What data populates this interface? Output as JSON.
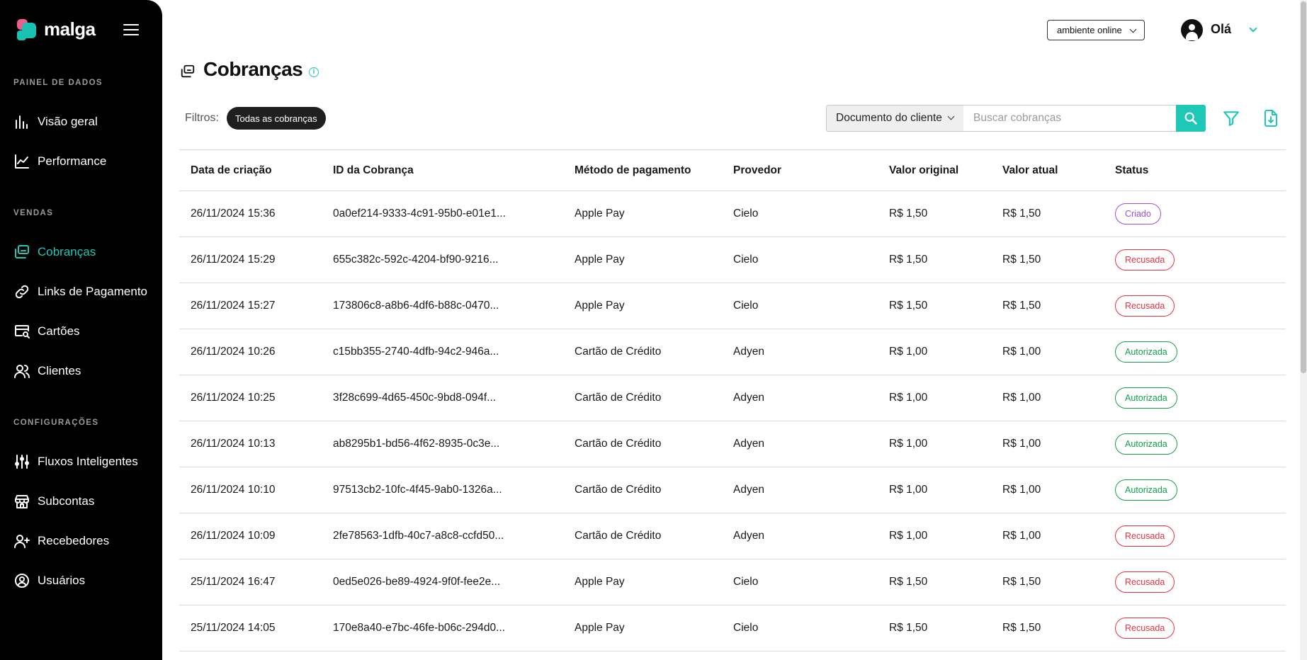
{
  "brand": {
    "name": "malga"
  },
  "sidebar": {
    "sections": [
      {
        "title": "PAINEL DE DADOS",
        "items": [
          {
            "label": "Visão geral",
            "icon": "bar-chart-icon"
          },
          {
            "label": "Performance",
            "icon": "line-chart-icon"
          }
        ]
      },
      {
        "title": "VENDAS",
        "items": [
          {
            "label": "Cobranças",
            "icon": "charges-icon",
            "active": true
          },
          {
            "label": "Links de Pagamento",
            "icon": "link-icon"
          },
          {
            "label": "Cartões",
            "icon": "card-search-icon"
          },
          {
            "label": "Clientes",
            "icon": "users-icon"
          }
        ]
      },
      {
        "title": "CONFIGURAÇÕES",
        "items": [
          {
            "label": "Fluxos Inteligentes",
            "icon": "sliders-icon"
          },
          {
            "label": "Subcontas",
            "icon": "store-icon"
          },
          {
            "label": "Recebedores",
            "icon": "user-plus-icon"
          },
          {
            "label": "Usuários",
            "icon": "user-circle-icon"
          }
        ]
      }
    ]
  },
  "header": {
    "environment": "ambiente online",
    "greeting": "Olá"
  },
  "page": {
    "title": "Cobranças",
    "filters_label": "Filtros:",
    "active_filter": "Todas as cobranças",
    "search_field_select": "Documento do cliente",
    "search_placeholder": "Buscar cobranças"
  },
  "table": {
    "columns": [
      "Data de criação",
      "ID da Cobrança",
      "Método de pagamento",
      "Provedor",
      "Valor original",
      "Valor atual",
      "Status"
    ],
    "rows": [
      {
        "date": "26/11/2024 15:36",
        "id": "0a0ef214-9333-4c91-95b0-e01e1...",
        "method": "Apple Pay",
        "provider": "Cielo",
        "original": "R$ 1,50",
        "current": "R$ 1,50",
        "status": "Criado",
        "status_type": "criado"
      },
      {
        "date": "26/11/2024 15:29",
        "id": "655c382c-592c-4204-bf90-9216...",
        "method": "Apple Pay",
        "provider": "Cielo",
        "original": "R$ 1,50",
        "current": "R$ 1,50",
        "status": "Recusada",
        "status_type": "recusada"
      },
      {
        "date": "26/11/2024 15:27",
        "id": "173806c8-a8b6-4df6-b88c-0470...",
        "method": "Apple Pay",
        "provider": "Cielo",
        "original": "R$ 1,50",
        "current": "R$ 1,50",
        "status": "Recusada",
        "status_type": "recusada"
      },
      {
        "date": "26/11/2024 10:26",
        "id": "c15bb355-2740-4dfb-94c2-946a...",
        "method": "Cartão de Crédito",
        "provider": "Adyen",
        "original": "R$ 1,00",
        "current": "R$ 1,00",
        "status": "Autorizada",
        "status_type": "autorizada"
      },
      {
        "date": "26/11/2024 10:25",
        "id": "3f28c699-4d65-450c-9bd8-094f...",
        "method": "Cartão de Crédito",
        "provider": "Adyen",
        "original": "R$ 1,00",
        "current": "R$ 1,00",
        "status": "Autorizada",
        "status_type": "autorizada"
      },
      {
        "date": "26/11/2024 10:13",
        "id": "ab8295b1-bd56-4f62-8935-0c3e...",
        "method": "Cartão de Crédito",
        "provider": "Adyen",
        "original": "R$ 1,00",
        "current": "R$ 1,00",
        "status": "Autorizada",
        "status_type": "autorizada"
      },
      {
        "date": "26/11/2024 10:10",
        "id": "97513cb2-10fc-4f45-9ab0-1326a...",
        "method": "Cartão de Crédito",
        "provider": "Adyen",
        "original": "R$ 1,00",
        "current": "R$ 1,00",
        "status": "Autorizada",
        "status_type": "autorizada"
      },
      {
        "date": "26/11/2024 10:09",
        "id": "2fe78563-1dfb-40c7-a8c8-ccfd50...",
        "method": "Cartão de Crédito",
        "provider": "Adyen",
        "original": "R$ 1,00",
        "current": "R$ 1,00",
        "status": "Recusada",
        "status_type": "recusada"
      },
      {
        "date": "25/11/2024 16:47",
        "id": "0ed5e026-be89-4924-9f0f-fee2e...",
        "method": "Apple Pay",
        "provider": "Cielo",
        "original": "R$ 1,50",
        "current": "R$ 1,50",
        "status": "Recusada",
        "status_type": "recusada"
      },
      {
        "date": "25/11/2024 14:05",
        "id": "170e8a40-e7bc-46fe-b06c-294d0...",
        "method": "Apple Pay",
        "provider": "Cielo",
        "original": "R$ 1,50",
        "current": "R$ 1,50",
        "status": "Recusada",
        "status_type": "recusada"
      }
    ]
  },
  "colors": {
    "accent": "#1fc7b6",
    "sidebar_bg": "#000000",
    "criado": "#9a4fd6",
    "recusada": "#e3343f",
    "autorizada": "#13a04a"
  }
}
